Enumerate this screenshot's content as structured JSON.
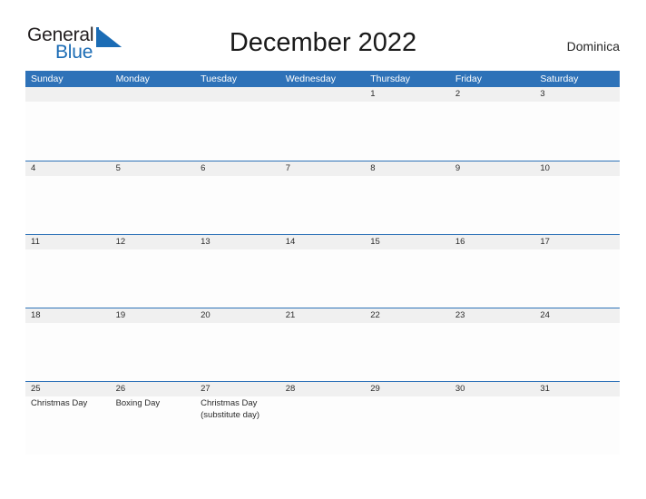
{
  "brand": {
    "word_one": "General",
    "word_two": "Blue",
    "triangle_icon": "blue-triangle-icon",
    "accent_color": "#1B6CB5"
  },
  "header": {
    "title": "December 2022",
    "country": "Dominica"
  },
  "colors": {
    "header_blue": "#2E72B8",
    "band_gray": "#F0F0F0",
    "text": "#2B2B2B",
    "page_background": "#FFFFFF"
  },
  "calendar": {
    "day_names": [
      "Sunday",
      "Monday",
      "Tuesday",
      "Wednesday",
      "Thursday",
      "Friday",
      "Saturday"
    ],
    "weeks": [
      [
        {
          "num": "",
          "event": ""
        },
        {
          "num": "",
          "event": ""
        },
        {
          "num": "",
          "event": ""
        },
        {
          "num": "",
          "event": ""
        },
        {
          "num": "1",
          "event": ""
        },
        {
          "num": "2",
          "event": ""
        },
        {
          "num": "3",
          "event": ""
        }
      ],
      [
        {
          "num": "4",
          "event": ""
        },
        {
          "num": "5",
          "event": ""
        },
        {
          "num": "6",
          "event": ""
        },
        {
          "num": "7",
          "event": ""
        },
        {
          "num": "8",
          "event": ""
        },
        {
          "num": "9",
          "event": ""
        },
        {
          "num": "10",
          "event": ""
        }
      ],
      [
        {
          "num": "11",
          "event": ""
        },
        {
          "num": "12",
          "event": ""
        },
        {
          "num": "13",
          "event": ""
        },
        {
          "num": "14",
          "event": ""
        },
        {
          "num": "15",
          "event": ""
        },
        {
          "num": "16",
          "event": ""
        },
        {
          "num": "17",
          "event": ""
        }
      ],
      [
        {
          "num": "18",
          "event": ""
        },
        {
          "num": "19",
          "event": ""
        },
        {
          "num": "20",
          "event": ""
        },
        {
          "num": "21",
          "event": ""
        },
        {
          "num": "22",
          "event": ""
        },
        {
          "num": "23",
          "event": ""
        },
        {
          "num": "24",
          "event": ""
        }
      ],
      [
        {
          "num": "25",
          "event": "Christmas Day"
        },
        {
          "num": "26",
          "event": "Boxing Day"
        },
        {
          "num": "27",
          "event": "Christmas Day\n(substitute day)"
        },
        {
          "num": "28",
          "event": ""
        },
        {
          "num": "29",
          "event": ""
        },
        {
          "num": "30",
          "event": ""
        },
        {
          "num": "31",
          "event": ""
        }
      ]
    ]
  }
}
